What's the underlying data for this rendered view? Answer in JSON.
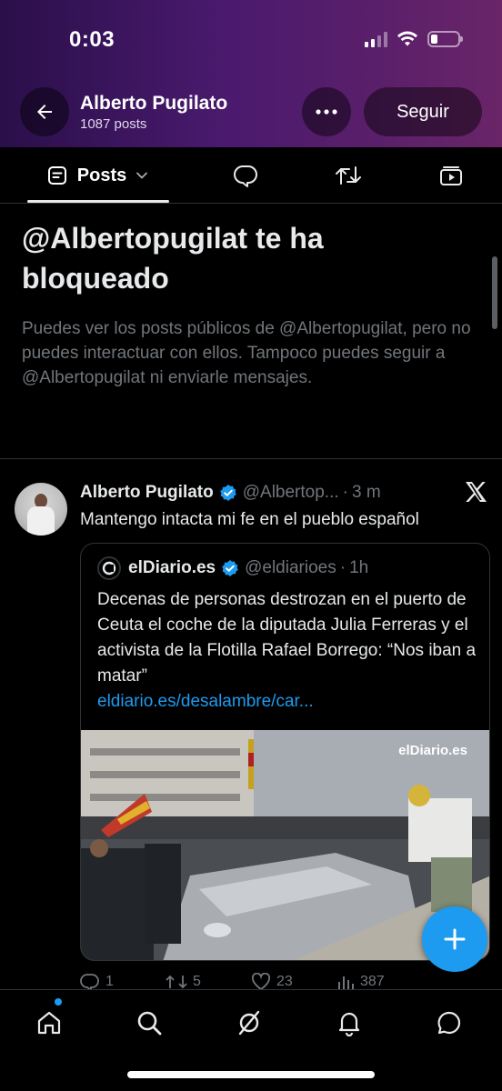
{
  "status_bar": {
    "time": "0:03",
    "battery_level": 0.25
  },
  "header": {
    "profile_name": "Alberto Pugilato",
    "post_count": "1087 posts",
    "follow_label": "Seguir"
  },
  "tabs": {
    "posts_label": "Posts"
  },
  "blocked_notice": {
    "title": "@Albertopugilat te ha bloqueado",
    "body": "Puedes ver los posts públicos de @Albertopugilat, pero no puedes interactuar con ellos. Tampoco puedes seguir a @Albertopugilat ni enviarle mensajes."
  },
  "tweet": {
    "author": "Alberto Pugilato",
    "handle": "@Albertop...",
    "time": "3 m",
    "text": "Mantengo intacta mi fe en el pueblo español",
    "quote": {
      "author": "elDiario.es",
      "handle": "@eldiarioes",
      "time": "1h",
      "text": "Decenas de personas destrozan en el puerto de Ceuta el coche de la diputada Julia Ferreras y el activista de la Flotilla Rafael Borrego: “Nos iban a matar”",
      "link": "eldiario.es/desalambre/car...",
      "media_watermark": "elDiario.es"
    },
    "stats": {
      "replies": "1",
      "reposts": "5",
      "likes": "23",
      "views": "387"
    }
  },
  "colors": {
    "accent": "#1d9bf0",
    "background": "#000000",
    "muted": "#71767b"
  }
}
